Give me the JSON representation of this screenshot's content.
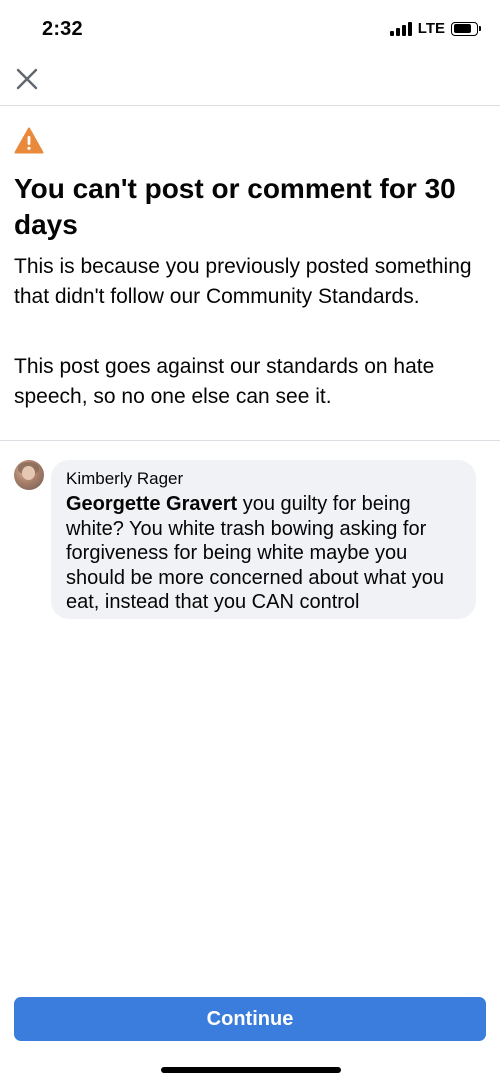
{
  "status_bar": {
    "time": "2:32",
    "network": "LTE",
    "signal_icon": "cellular-signal-icon",
    "battery_icon": "battery-icon",
    "battery_level": 0.8
  },
  "header": {
    "close_icon": "close-icon"
  },
  "notice": {
    "icon": "warning-triangle-icon",
    "icon_color": "#e8893b",
    "title": "You can't post or comment for 30 days",
    "body": "This is because you previously posted something that didn't follow our Community Standards.",
    "detail": "This post goes against our standards on hate speech, so no one else can see it."
  },
  "comment": {
    "avatar_icon": "profile-photo",
    "author": "Kimberly Rager",
    "mention": "Georgette Gravert",
    "text": " you guilty for being white? You white trash bowing asking for forgiveness for being white maybe you should be more concerned about what you eat, instead that you CAN control"
  },
  "footer": {
    "continue_label": "Continue",
    "button_color": "#3b7ddd"
  }
}
